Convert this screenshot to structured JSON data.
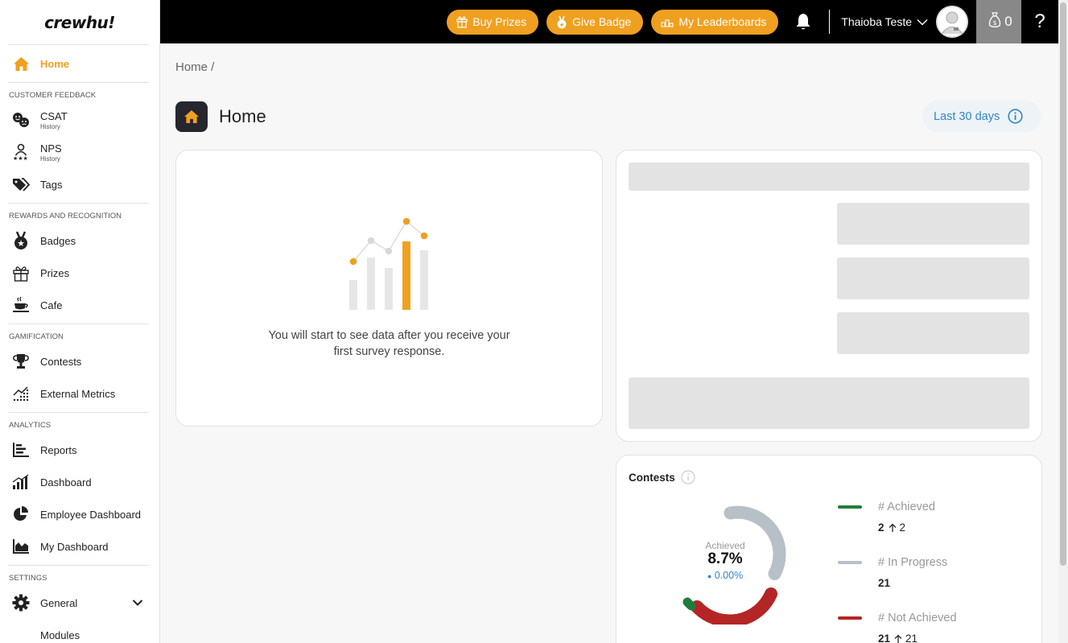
{
  "app": {
    "logo": "crewhu!"
  },
  "sidebar": {
    "home": "Home",
    "sections": {
      "customer_feedback": "CUSTOMER FEEDBACK",
      "rewards": "REWARDS AND RECOGNITION",
      "gamification": "GAMIFICATION",
      "analytics": "ANALYTICS",
      "settings": "SETTINGS"
    },
    "csat": {
      "label": "CSAT",
      "sub": "History"
    },
    "nps": {
      "label": "NPS",
      "sub": "History"
    },
    "tags": "Tags",
    "badges": "Badges",
    "prizes": "Prizes",
    "cafe": "Cafe",
    "contests": "Contests",
    "external_metrics": "External Metrics",
    "reports": "Reports",
    "dashboard": "Dashboard",
    "employee_dashboard": "Employee Dashboard",
    "my_dashboard": "My Dashboard",
    "general": "General",
    "modules": "Modules"
  },
  "topbar": {
    "buy_prizes": "Buy Prizes",
    "give_badge": "Give Badge",
    "my_leaderboards": "My Leaderboards",
    "user_name": "Thaioba Teste",
    "coins": "0",
    "help": "?"
  },
  "breadcrumb": "Home /",
  "page": {
    "title": "Home",
    "range": "Last 30 days"
  },
  "empty_state": {
    "line1": "You will start to see data after you receive your",
    "line2": "first survey response."
  },
  "contests": {
    "title": "Contests",
    "center_label": "Achieved",
    "center_value": "8.7%",
    "center_delta": "0.00%",
    "legend": [
      {
        "label": "# Achieved",
        "value": "2",
        "delta": "2",
        "color": "#1e7d3a",
        "has_delta": true
      },
      {
        "label": "# In Progress",
        "value": "21",
        "delta": "",
        "color": "#b7c0c6",
        "has_delta": false
      },
      {
        "label": "# Not Achieved",
        "value": "21",
        "delta": "21",
        "color": "#b52525",
        "has_delta": true
      }
    ]
  },
  "colors": {
    "accent": "#f0a020",
    "link": "#2f86c8",
    "topbar": "#000000"
  }
}
